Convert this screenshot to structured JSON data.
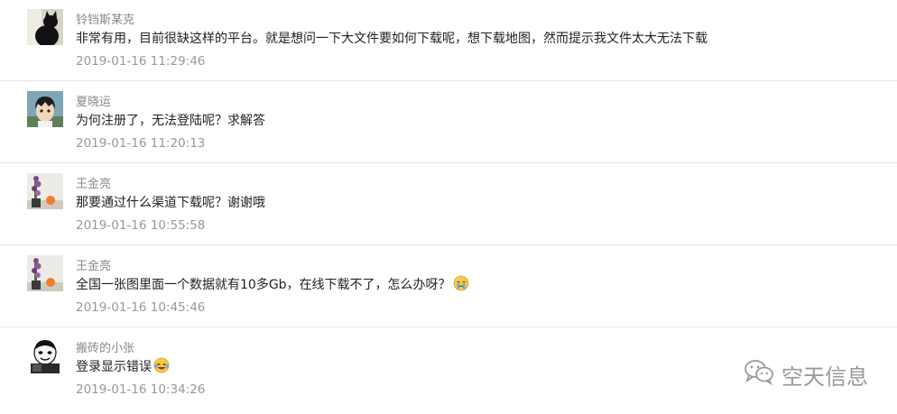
{
  "comments": [
    {
      "username": "铃铛斯某克",
      "text": "非常有用，目前很缺这样的平台。就是想问一下大文件要如何下载呢，想下载地图，然而提示我文件太大无法下载",
      "time": "2019-01-16 11:29:46",
      "avatar": "black-cat-avatar"
    },
    {
      "username": "夏晓运",
      "text": "为何注册了，无法登陆呢？求解答",
      "time": "2019-01-16 11:20:13",
      "avatar": "anime-boy-avatar"
    },
    {
      "username": "王金亮",
      "text": "那要通过什么渠道下载呢？谢谢哦",
      "time": "2019-01-16 10:55:58",
      "avatar": "flower-vase-avatar"
    },
    {
      "username": "王金亮",
      "text": "全国一张图里面一个数据就有10多Gb，在线下载不了，怎么办呀？",
      "time": "2019-01-16 10:45:46",
      "avatar": "flower-vase-avatar",
      "emoji": "crying-emoji"
    },
    {
      "username": "搬砖的小张",
      "text": "登录显示错误",
      "time": "2019-01-16 10:34:26",
      "avatar": "cartoon-meme-avatar",
      "emoji": "laughing-tears-emoji"
    }
  ],
  "watermark": {
    "text": "空天信息",
    "icon": "wechat-icon"
  }
}
